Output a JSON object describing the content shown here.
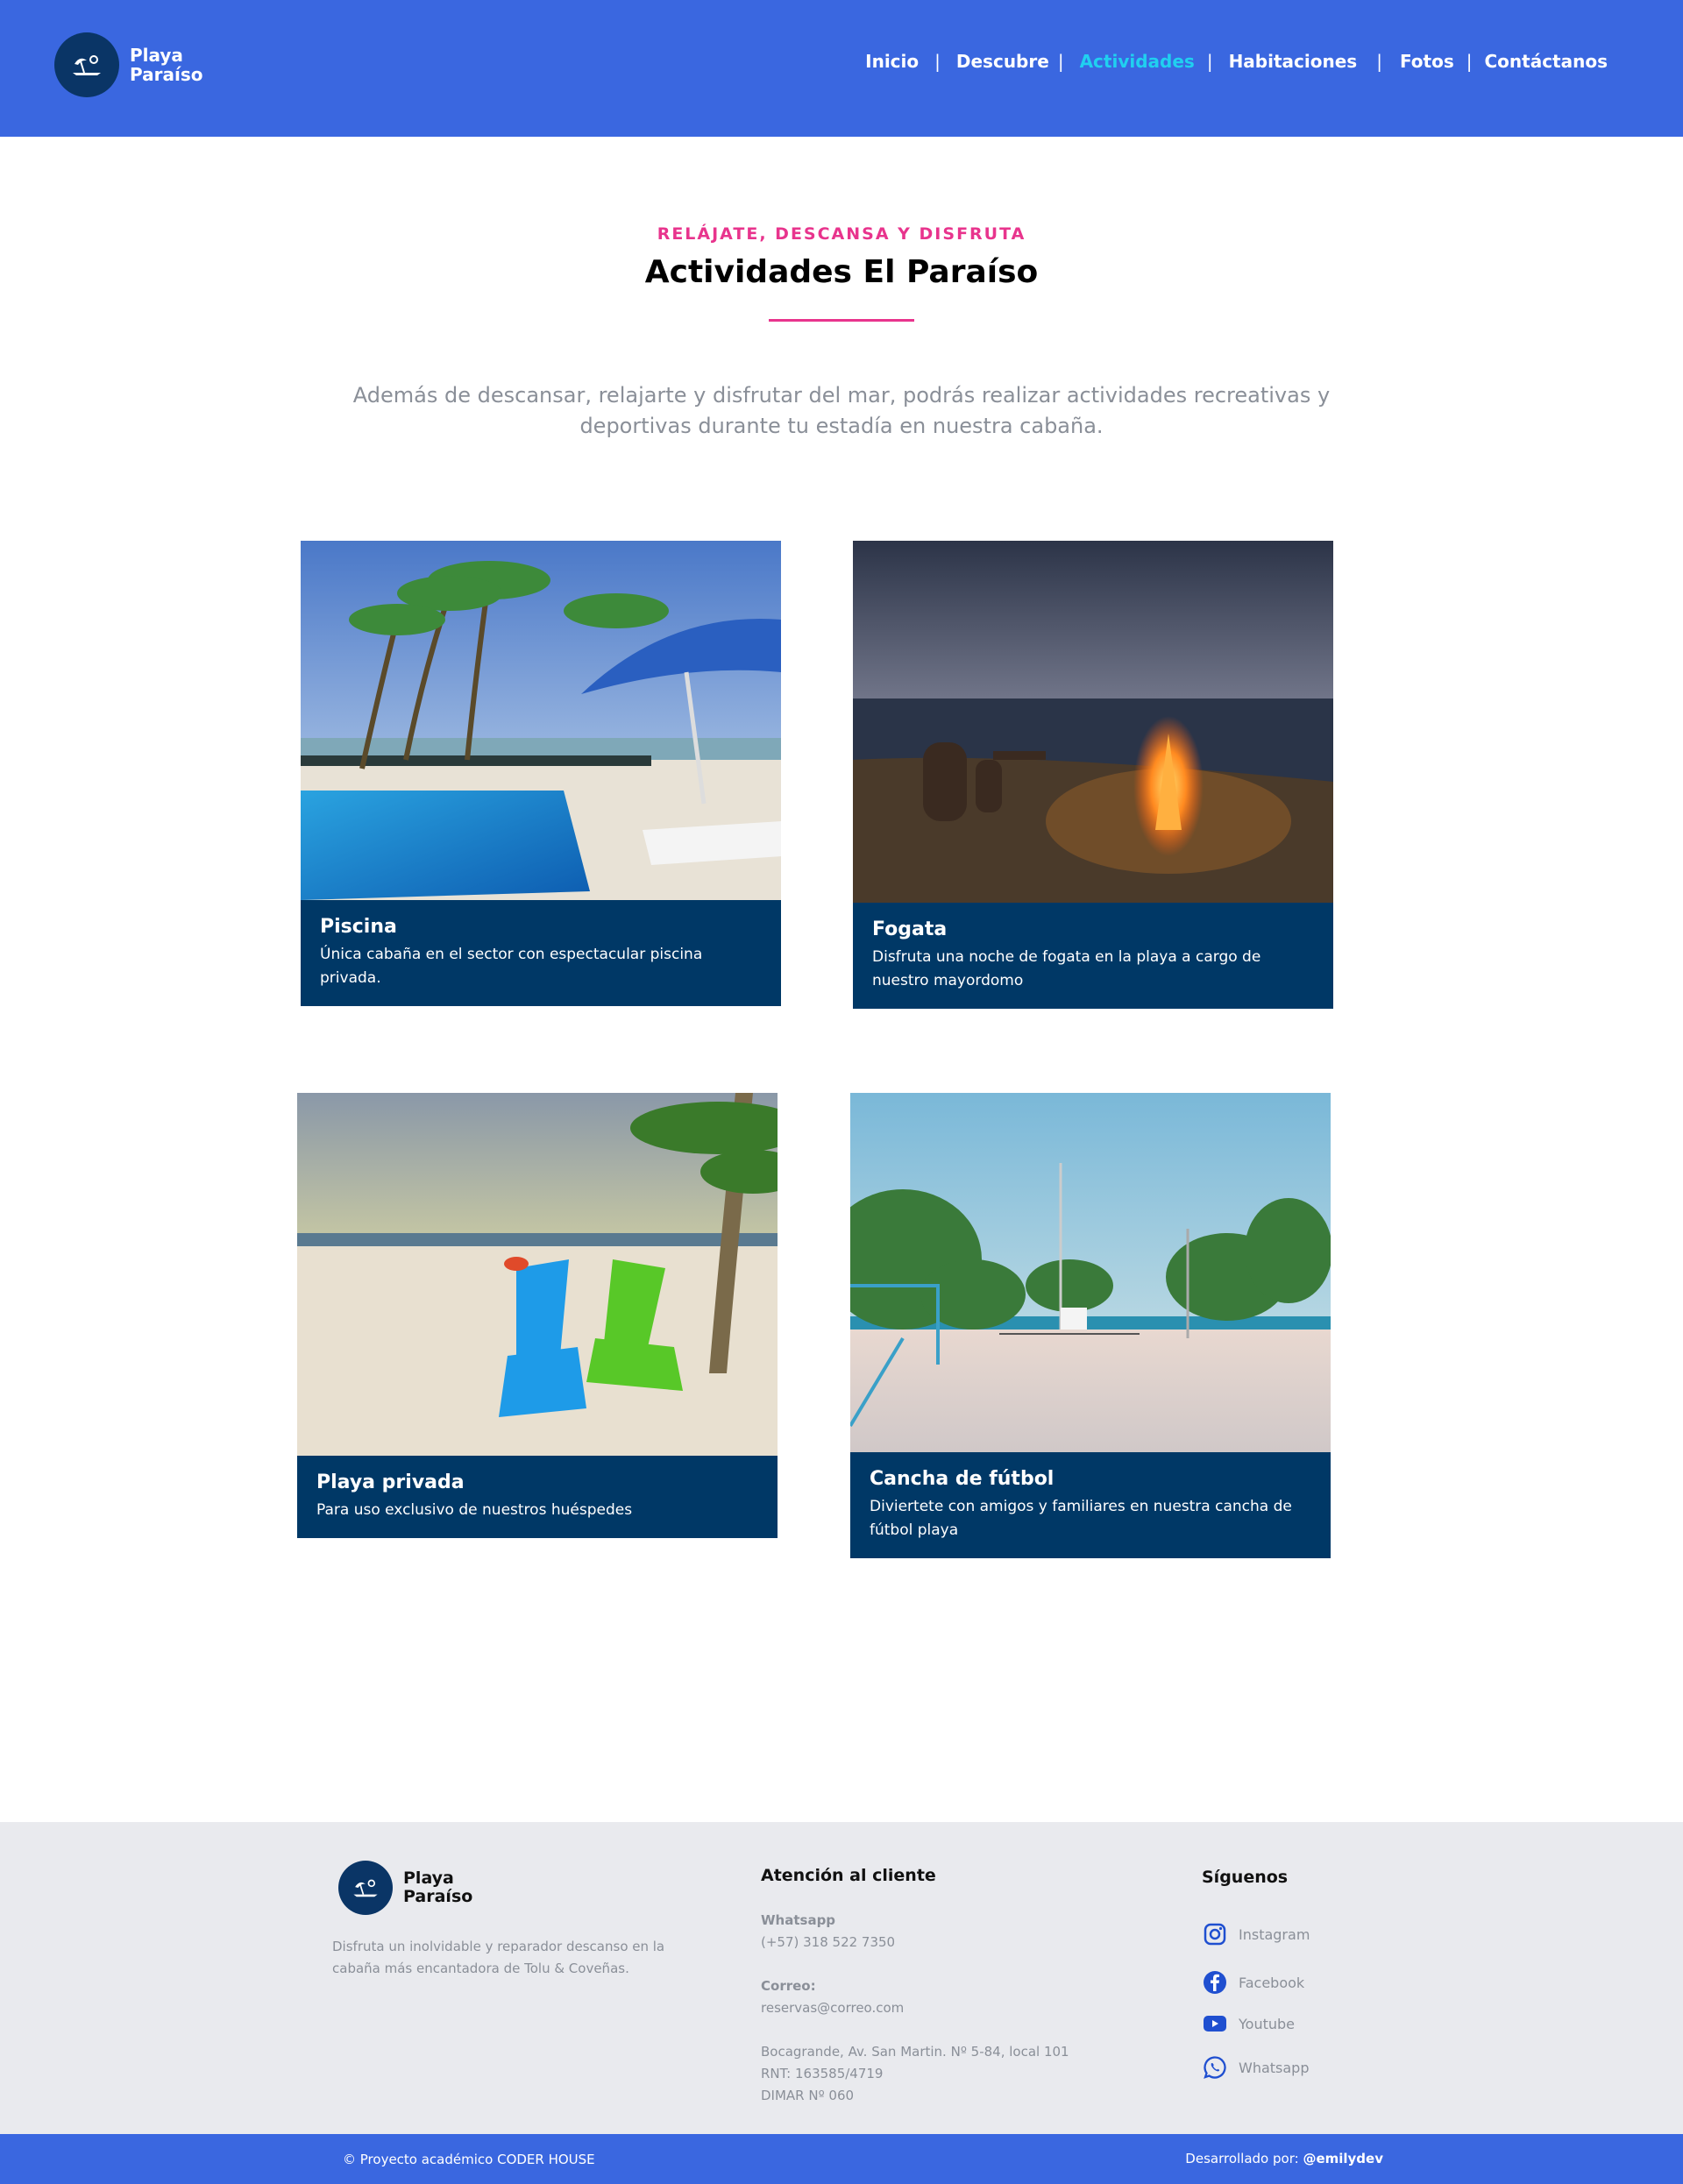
{
  "brand": {
    "line1": "Playa",
    "line2": "Paraíso",
    "icon": "palm-umbrella-icon"
  },
  "nav": {
    "items": [
      {
        "label": "Inicio"
      },
      {
        "label": "Descubre"
      },
      {
        "label": "Actividades",
        "active": true
      },
      {
        "label": "Habitaciones"
      },
      {
        "label": "Fotos"
      },
      {
        "label": "Contáctanos"
      }
    ],
    "separator": "|"
  },
  "hero": {
    "kicker": "RELÁJATE, DESCANSA Y DISFRUTA",
    "title": "Actividades El Paraíso",
    "intro": "Además de descansar, relajarte y disfrutar del mar, podrás realizar actividades recreativas y deportivas durante tu estadía en nuestra cabaña."
  },
  "cards": [
    {
      "title": "Piscina",
      "desc": "Única cabaña en el sector con espectacular piscina privada."
    },
    {
      "title": "Fogata",
      "desc": "Disfruta una noche de fogata en la playa a cargo de nuestro mayordomo"
    },
    {
      "title": "Playa privada",
      "desc": "Para uso exclusivo de nuestros huéspedes"
    },
    {
      "title": "Cancha de fútbol",
      "desc": "Diviertete con amigos y familiares en nuestra cancha de fútbol playa"
    }
  ],
  "footer": {
    "about": "Disfruta un inolvidable y reparador descanso en la cabaña más encantadora de Tolu & Coveñas.",
    "contact_title": "Atención al cliente",
    "whatsapp_label": "Whatsapp",
    "whatsapp_value": "(+57) 318 522 7350",
    "email_label": "Correo:",
    "email_value": "reservas@correo.com",
    "address": "Bocagrande, Av. San Martin. Nº 5-84, local 101",
    "rnt": "RNT: 163585/4719",
    "dimar": "DIMAR Nº 060",
    "follow_title": "Síguenos",
    "social": [
      {
        "label": "Instagram",
        "icon": "instagram-icon"
      },
      {
        "label": "Facebook",
        "icon": "facebook-icon"
      },
      {
        "label": "Youtube",
        "icon": "youtube-icon"
      },
      {
        "label": "Whatsapp",
        "icon": "whatsapp-icon"
      }
    ],
    "copyright": "© Proyecto académico CODER HOUSE",
    "dev_prefix": "Desarrollado por:",
    "dev_handle": "@emilydev"
  },
  "colors": {
    "primary": "#3a67e0",
    "navy": "#003866",
    "accent": "#e8348d",
    "active_nav": "#20d0f0"
  }
}
